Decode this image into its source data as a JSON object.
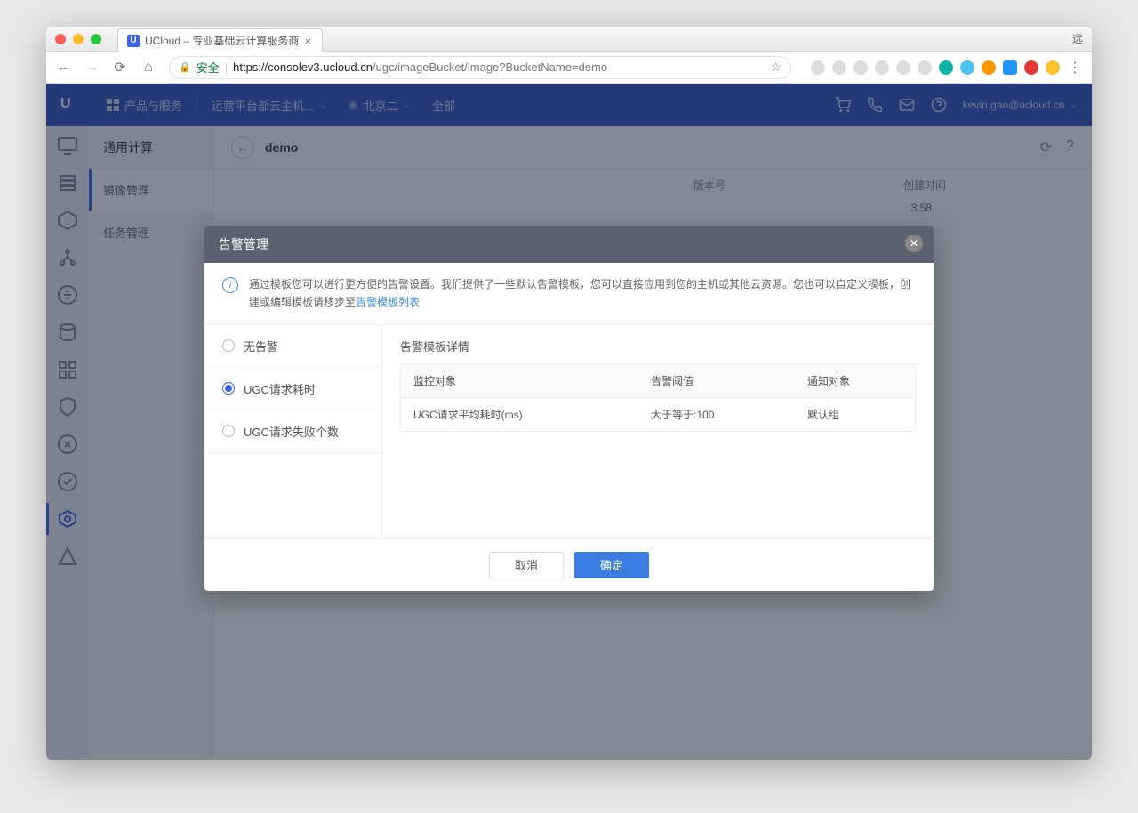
{
  "browser": {
    "tab_title": "UCloud – 专业基础云计算服务商",
    "profile": "远",
    "secure_label": "安全",
    "url_host": "https://consolev3.ucloud.cn",
    "url_path": "/ugc/imageBucket/image?BucketName=demo"
  },
  "topbar": {
    "products": "产品与服务",
    "project": "运营平台部云主机...",
    "region": "北京二",
    "scope": "全部",
    "user": "kevin.gao@ucloud.cn"
  },
  "sidebar": {
    "title": "通用计算",
    "items": [
      "镜像管理",
      "任务管理"
    ]
  },
  "content": {
    "title": "demo",
    "col_version": "版本号",
    "col_time": "创建时间",
    "time_fragment": "3:58"
  },
  "modal": {
    "title": "告警管理",
    "info_text": "通过模板您可以进行更方便的告警设置。我们提供了一些默认告警模板，您可以直接应用到您的主机或其他云资源。您也可以自定义模板，创建或编辑模板请移步至",
    "info_link": "告警模板列表",
    "options": [
      "无告警",
      "UGC请求耗时",
      "UGC请求失败个数"
    ],
    "selected_index": 1,
    "detail_title": "告警模板详情",
    "table": {
      "headers": [
        "监控对象",
        "告警阈值",
        "通知对象"
      ],
      "rows": [
        [
          "UGC请求平均耗时(ms)",
          "大于等于:100",
          "默认组"
        ]
      ]
    },
    "cancel": "取消",
    "confirm": "确定"
  }
}
